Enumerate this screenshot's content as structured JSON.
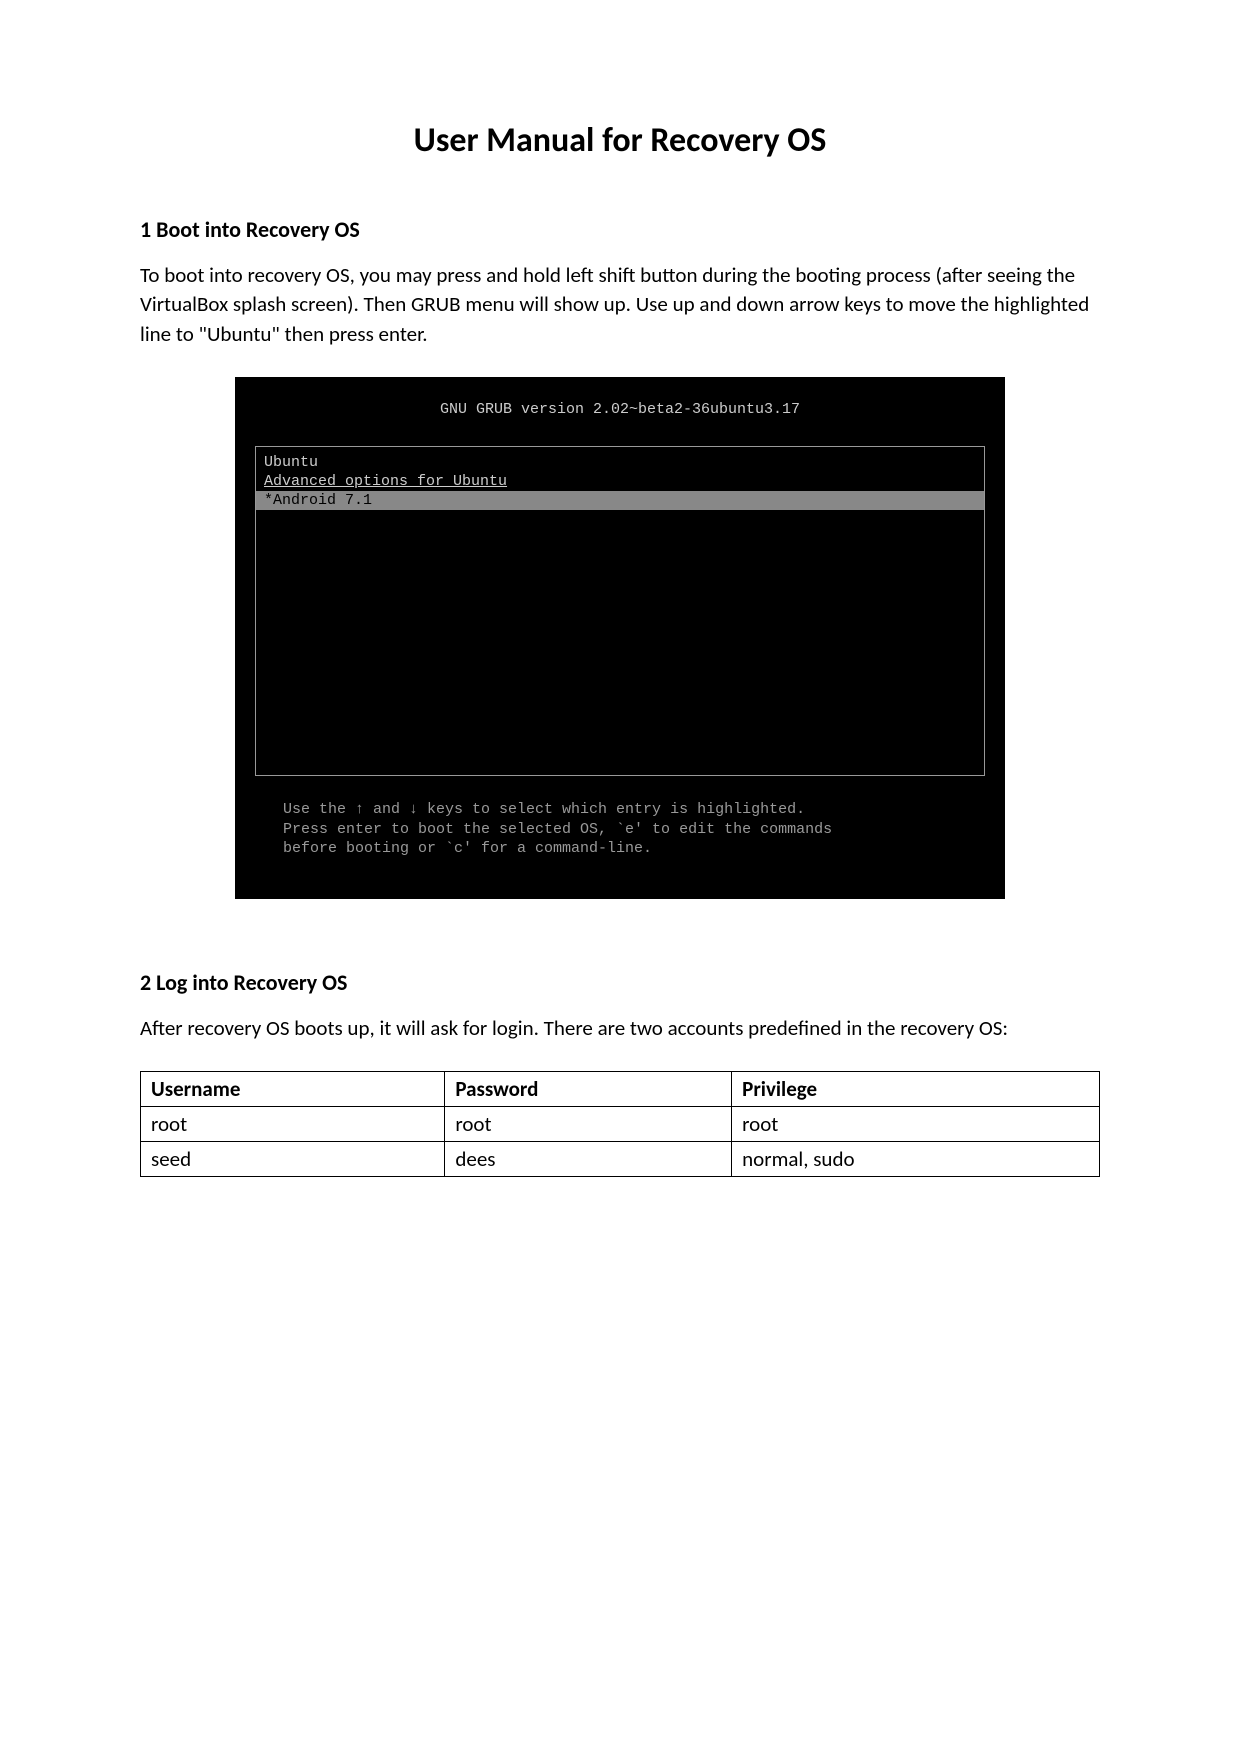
{
  "title": "User Manual for Recovery OS",
  "section1": {
    "heading": "1 Boot into Recovery OS",
    "paragraph": "To boot into recovery OS, you may press and hold left shift button during the booting process (after seeing the VirtualBox splash screen). Then GRUB menu will show up. Use up and down arrow keys to move the highlighted line to \"Ubuntu\" then press enter."
  },
  "grub": {
    "header": "GNU GRUB  version 2.02~beta2-36ubuntu3.17",
    "items": [
      {
        "label": "Ubuntu",
        "selected": false
      },
      {
        "label": "Advanced options for Ubuntu",
        "selected": false,
        "underlined": true
      },
      {
        "label": "*Android 7.1",
        "selected": true
      }
    ],
    "hint_line1": "Use the ↑ and ↓ keys to select which entry is highlighted.",
    "hint_line2": "Press enter to boot the selected OS, `e' to edit the commands",
    "hint_line3": "before booting or `c' for a command-line."
  },
  "section2": {
    "heading": "2 Log into Recovery OS",
    "paragraph": "After recovery OS boots up, it will ask for login. There are two accounts predefined in the recovery OS:"
  },
  "accounts_table": {
    "headers": [
      "Username",
      "Password",
      "Privilege"
    ],
    "rows": [
      [
        "root",
        "root",
        "root"
      ],
      [
        "seed",
        "dees",
        "normal, sudo"
      ]
    ]
  }
}
